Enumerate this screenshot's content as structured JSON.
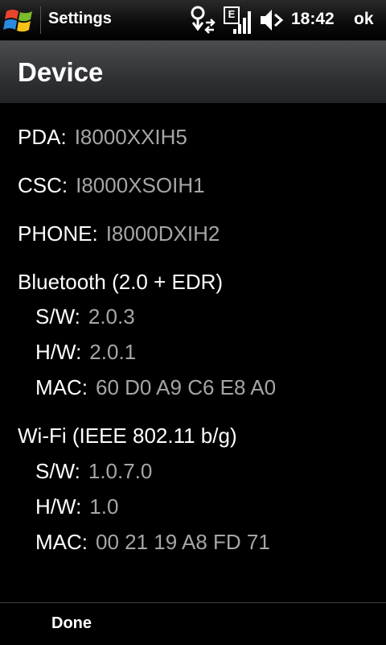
{
  "status_bar": {
    "app_title": "Settings",
    "network_type": "E",
    "time": "18:42",
    "ok_label": "ok",
    "icons": [
      "windows-start-icon",
      "connectivity-icon",
      "signal-strength-icon",
      "speaker-icon"
    ]
  },
  "header": {
    "title": "Device"
  },
  "info": {
    "pda": {
      "label": "PDA:",
      "value": "I8000XXIH5"
    },
    "csc": {
      "label": "CSC:",
      "value": "I8000XSOIH1"
    },
    "phone": {
      "label": "PHONE:",
      "value": "I8000DXIH2"
    },
    "bluetooth": {
      "title": "Bluetooth (2.0 + EDR)",
      "sw": {
        "label": "S/W:",
        "value": "2.0.3"
      },
      "hw": {
        "label": "H/W:",
        "value": "2.0.1"
      },
      "mac": {
        "label": "MAC:",
        "value": "60 D0 A9 C6 E8 A0"
      }
    },
    "wifi": {
      "title": "Wi-Fi (IEEE 802.11 b/g)",
      "sw": {
        "label": "S/W:",
        "value": "1.0.7.0"
      },
      "hw": {
        "label": "H/W:",
        "value": "1.0"
      },
      "mac": {
        "label": "MAC:",
        "value": "00 21 19 A8 FD 71"
      }
    }
  },
  "softkeys": {
    "left": "Done"
  },
  "colors": {
    "value_text": "#a6a6a6",
    "background": "#000000",
    "header_bg": "#3a3c3f"
  }
}
